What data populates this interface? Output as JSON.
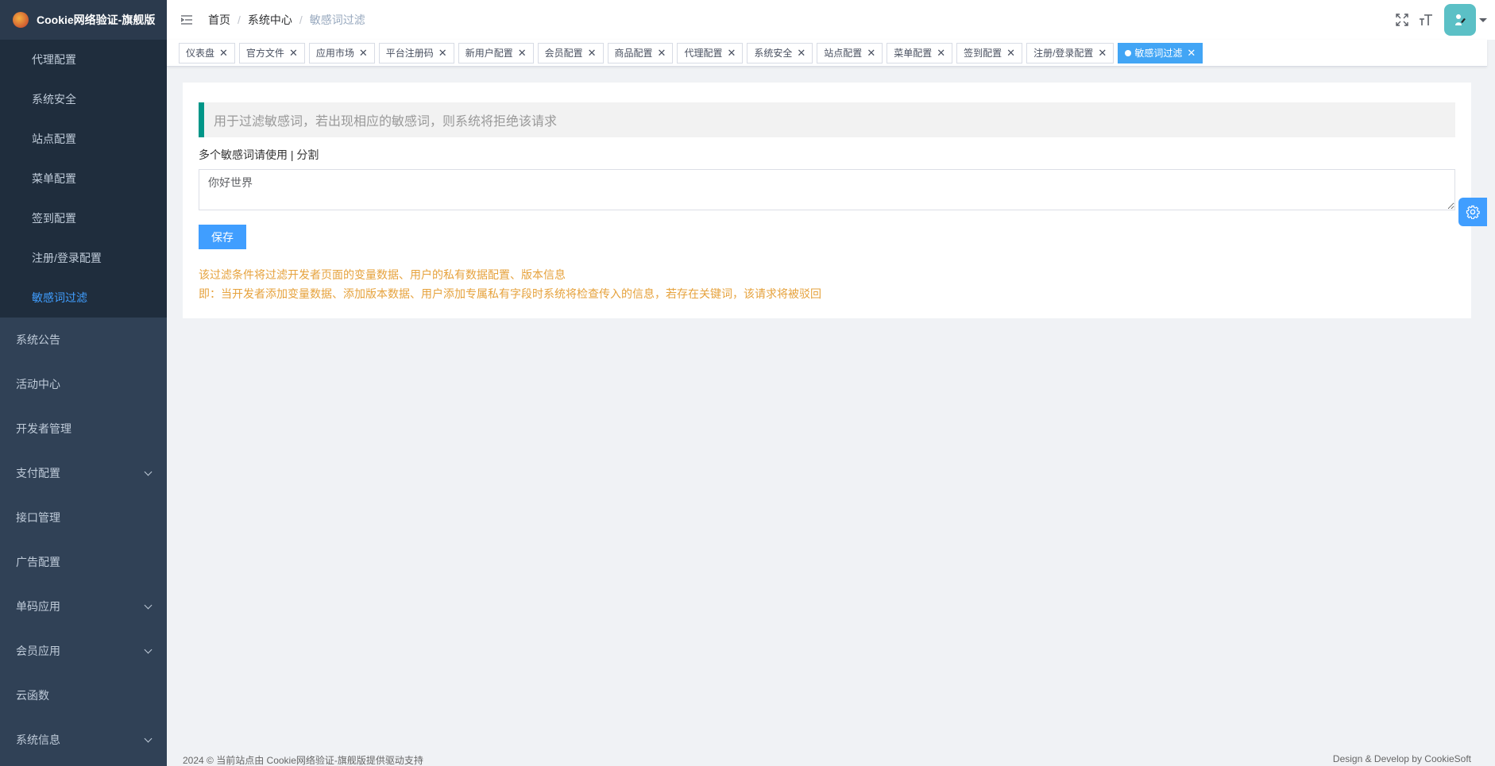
{
  "brand": {
    "title": "Cookie网络验证-旗舰版"
  },
  "sidebar": {
    "sub_items": [
      {
        "label": "代理配置",
        "active": false
      },
      {
        "label": "系统安全",
        "active": false
      },
      {
        "label": "站点配置",
        "active": false
      },
      {
        "label": "菜单配置",
        "active": false
      },
      {
        "label": "签到配置",
        "active": false
      },
      {
        "label": "注册/登录配置",
        "active": false
      },
      {
        "label": "敏感词过滤",
        "active": true
      }
    ],
    "items": [
      {
        "label": "系统公告",
        "expandable": false
      },
      {
        "label": "活动中心",
        "expandable": false
      },
      {
        "label": "开发者管理",
        "expandable": false
      },
      {
        "label": "支付配置",
        "expandable": true
      },
      {
        "label": "接口管理",
        "expandable": false
      },
      {
        "label": "广告配置",
        "expandable": false
      },
      {
        "label": "单码应用",
        "expandable": true
      },
      {
        "label": "会员应用",
        "expandable": true
      },
      {
        "label": "云函数",
        "expandable": false
      },
      {
        "label": "系统信息",
        "expandable": true
      }
    ]
  },
  "breadcrumb": {
    "home": "首页",
    "section": "系统中心",
    "current": "敏感词过滤",
    "separator": "/"
  },
  "tags": [
    {
      "label": "仪表盘",
      "active": false
    },
    {
      "label": "官方文件",
      "active": false
    },
    {
      "label": "应用市场",
      "active": false
    },
    {
      "label": "平台注册码",
      "active": false
    },
    {
      "label": "新用户配置",
      "active": false
    },
    {
      "label": "会员配置",
      "active": false
    },
    {
      "label": "商品配置",
      "active": false
    },
    {
      "label": "代理配置",
      "active": false
    },
    {
      "label": "系统安全",
      "active": false
    },
    {
      "label": "站点配置",
      "active": false
    },
    {
      "label": "菜单配置",
      "active": false
    },
    {
      "label": "签到配置",
      "active": false
    },
    {
      "label": "注册/登录配置",
      "active": false
    },
    {
      "label": "敏感词过滤",
      "active": true
    }
  ],
  "main": {
    "tip": "用于过滤敏感词，若出现相应的敏感词，则系统将拒绝该请求",
    "hint": "多个敏感词请使用 | 分割",
    "words_value": "你好世界",
    "save_label": "保存",
    "note_1": "该过滤条件将过滤开发者页面的变量数据、用户的私有数据配置、版本信息",
    "note_2": "即：当开发者添加变量数据、添加版本数据、用户添加专属私有字段时系统将检查传入的信息，若存在关键词，该请求将被驳回"
  },
  "footer": {
    "left": "2024 © 当前站点由 Cookie网络验证-旗舰版提供驱动支持",
    "right": "Design & Develop by CookieSoft"
  },
  "icons": {
    "hamburger": "hamburger-icon",
    "fullscreen": "fullscreen-icon",
    "font_size": "font-size-icon",
    "settings": "gear-icon",
    "close": "close-icon",
    "chevron": "chevron-down-icon"
  },
  "colors": {
    "sidebar_bg": "#304156",
    "submenu_bg": "#1f2d3d",
    "accent": "#409eff",
    "active_tag": "#42a5f5",
    "tip_border": "#009688",
    "warning_text": "#e6a23c"
  }
}
